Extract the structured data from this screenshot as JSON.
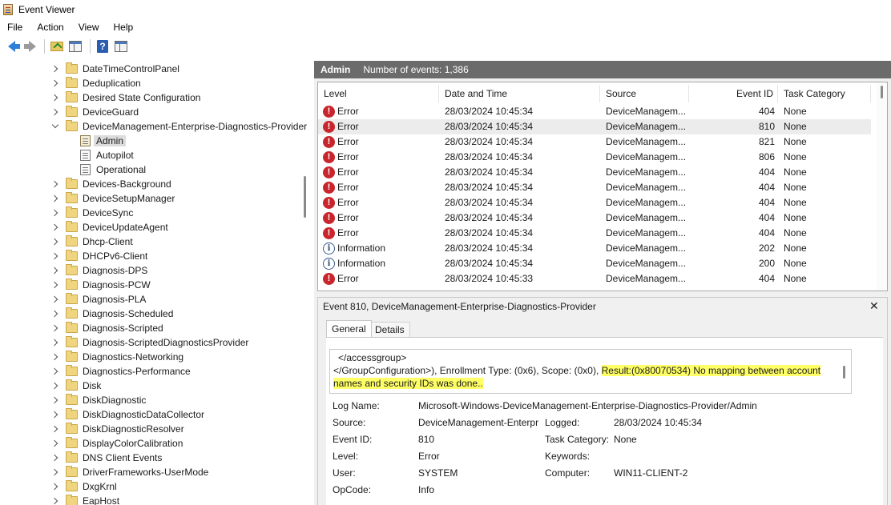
{
  "window": {
    "title": "Event Viewer"
  },
  "menu": {
    "items": [
      "File",
      "Action",
      "View",
      "Help"
    ]
  },
  "tree": {
    "items": [
      {
        "label": "DateTimeControlPanel",
        "kind": "folder",
        "state": "collapsed"
      },
      {
        "label": "Deduplication",
        "kind": "folder",
        "state": "collapsed"
      },
      {
        "label": "Desired State Configuration",
        "kind": "folder",
        "state": "collapsed"
      },
      {
        "label": "DeviceGuard",
        "kind": "folder",
        "state": "collapsed"
      },
      {
        "label": "DeviceManagement-Enterprise-Diagnostics-Provider",
        "kind": "folder",
        "state": "expanded"
      },
      {
        "label": "Admin",
        "kind": "log",
        "selected": true
      },
      {
        "label": "Autopilot",
        "kind": "log"
      },
      {
        "label": "Operational",
        "kind": "log"
      },
      {
        "label": "Devices-Background",
        "kind": "folder",
        "state": "collapsed"
      },
      {
        "label": "DeviceSetupManager",
        "kind": "folder",
        "state": "collapsed"
      },
      {
        "label": "DeviceSync",
        "kind": "folder",
        "state": "collapsed"
      },
      {
        "label": "DeviceUpdateAgent",
        "kind": "folder",
        "state": "collapsed"
      },
      {
        "label": "Dhcp-Client",
        "kind": "folder",
        "state": "collapsed"
      },
      {
        "label": "DHCPv6-Client",
        "kind": "folder",
        "state": "collapsed"
      },
      {
        "label": "Diagnosis-DPS",
        "kind": "folder",
        "state": "collapsed"
      },
      {
        "label": "Diagnosis-PCW",
        "kind": "folder",
        "state": "collapsed"
      },
      {
        "label": "Diagnosis-PLA",
        "kind": "folder",
        "state": "collapsed"
      },
      {
        "label": "Diagnosis-Scheduled",
        "kind": "folder",
        "state": "collapsed"
      },
      {
        "label": "Diagnosis-Scripted",
        "kind": "folder",
        "state": "collapsed"
      },
      {
        "label": "Diagnosis-ScriptedDiagnosticsProvider",
        "kind": "folder",
        "state": "collapsed"
      },
      {
        "label": "Diagnostics-Networking",
        "kind": "folder",
        "state": "collapsed"
      },
      {
        "label": "Diagnostics-Performance",
        "kind": "folder",
        "state": "collapsed"
      },
      {
        "label": "Disk",
        "kind": "folder",
        "state": "collapsed"
      },
      {
        "label": "DiskDiagnostic",
        "kind": "folder",
        "state": "collapsed"
      },
      {
        "label": "DiskDiagnosticDataCollector",
        "kind": "folder",
        "state": "collapsed"
      },
      {
        "label": "DiskDiagnosticResolver",
        "kind": "folder",
        "state": "collapsed"
      },
      {
        "label": "DisplayColorCalibration",
        "kind": "folder",
        "state": "collapsed"
      },
      {
        "label": "DNS Client Events",
        "kind": "folder",
        "state": "collapsed"
      },
      {
        "label": "DriverFrameworks-UserMode",
        "kind": "folder",
        "state": "collapsed"
      },
      {
        "label": "DxgKrnl",
        "kind": "folder",
        "state": "collapsed"
      },
      {
        "label": "EapHost",
        "kind": "folder",
        "state": "collapsed"
      }
    ]
  },
  "log_header": {
    "title": "Admin",
    "count_text": "Number of events: 1,386"
  },
  "columns": [
    "Level",
    "Date and Time",
    "Source",
    "Event ID",
    "Task Category"
  ],
  "events": [
    {
      "level": "Error",
      "datetime": "28/03/2024 10:45:34",
      "source": "DeviceManagem...",
      "event_id": "404",
      "category": "None"
    },
    {
      "level": "Error",
      "datetime": "28/03/2024 10:45:34",
      "source": "DeviceManagem...",
      "event_id": "810",
      "category": "None",
      "selected": true
    },
    {
      "level": "Error",
      "datetime": "28/03/2024 10:45:34",
      "source": "DeviceManagem...",
      "event_id": "821",
      "category": "None"
    },
    {
      "level": "Error",
      "datetime": "28/03/2024 10:45:34",
      "source": "DeviceManagem...",
      "event_id": "806",
      "category": "None"
    },
    {
      "level": "Error",
      "datetime": "28/03/2024 10:45:34",
      "source": "DeviceManagem...",
      "event_id": "404",
      "category": "None"
    },
    {
      "level": "Error",
      "datetime": "28/03/2024 10:45:34",
      "source": "DeviceManagem...",
      "event_id": "404",
      "category": "None"
    },
    {
      "level": "Error",
      "datetime": "28/03/2024 10:45:34",
      "source": "DeviceManagem...",
      "event_id": "404",
      "category": "None"
    },
    {
      "level": "Error",
      "datetime": "28/03/2024 10:45:34",
      "source": "DeviceManagem...",
      "event_id": "404",
      "category": "None"
    },
    {
      "level": "Error",
      "datetime": "28/03/2024 10:45:34",
      "source": "DeviceManagem...",
      "event_id": "404",
      "category": "None"
    },
    {
      "level": "Information",
      "datetime": "28/03/2024 10:45:34",
      "source": "DeviceManagem...",
      "event_id": "202",
      "category": "None"
    },
    {
      "level": "Information",
      "datetime": "28/03/2024 10:45:34",
      "source": "DeviceManagem...",
      "event_id": "200",
      "category": "None"
    },
    {
      "level": "Error",
      "datetime": "28/03/2024 10:45:33",
      "source": "DeviceManagem...",
      "event_id": "404",
      "category": "None"
    }
  ],
  "detail": {
    "title": "Event 810, DeviceManagement-Enterprise-Diagnostics-Provider",
    "tabs": {
      "general": "General",
      "details": "Details"
    },
    "description": {
      "line1": "</accessgroup>",
      "line2_prefix": "</GroupConfiguration>), Enrollment Type: (0x6), Scope: (0x0), ",
      "line2_highlight": "Result:(0x80070534) No mapping between account",
      "line3_highlight": "names and security IDs was done.."
    },
    "props": {
      "log_name_label": "Log Name:",
      "log_name_value": "Microsoft-Windows-DeviceManagement-Enterprise-Diagnostics-Provider/Admin",
      "source_label": "Source:",
      "source_value": "DeviceManagement-Enterpr",
      "logged_label": "Logged:",
      "logged_value": "28/03/2024 10:45:34",
      "event_id_label": "Event ID:",
      "event_id_value": "810",
      "task_category_label": "Task Category:",
      "task_category_value": "None",
      "level_label": "Level:",
      "level_value": "Error",
      "keywords_label": "Keywords:",
      "keywords_value": "",
      "user_label": "User:",
      "user_value": "SYSTEM",
      "computer_label": "Computer:",
      "computer_value": "WIN11-CLIENT-2",
      "opcode_label": "OpCode:",
      "opcode_value": "Info"
    }
  },
  "colors": {
    "error": "#c8262c",
    "highlight": "#ffff66",
    "header_bar": "#6b6b6b"
  }
}
